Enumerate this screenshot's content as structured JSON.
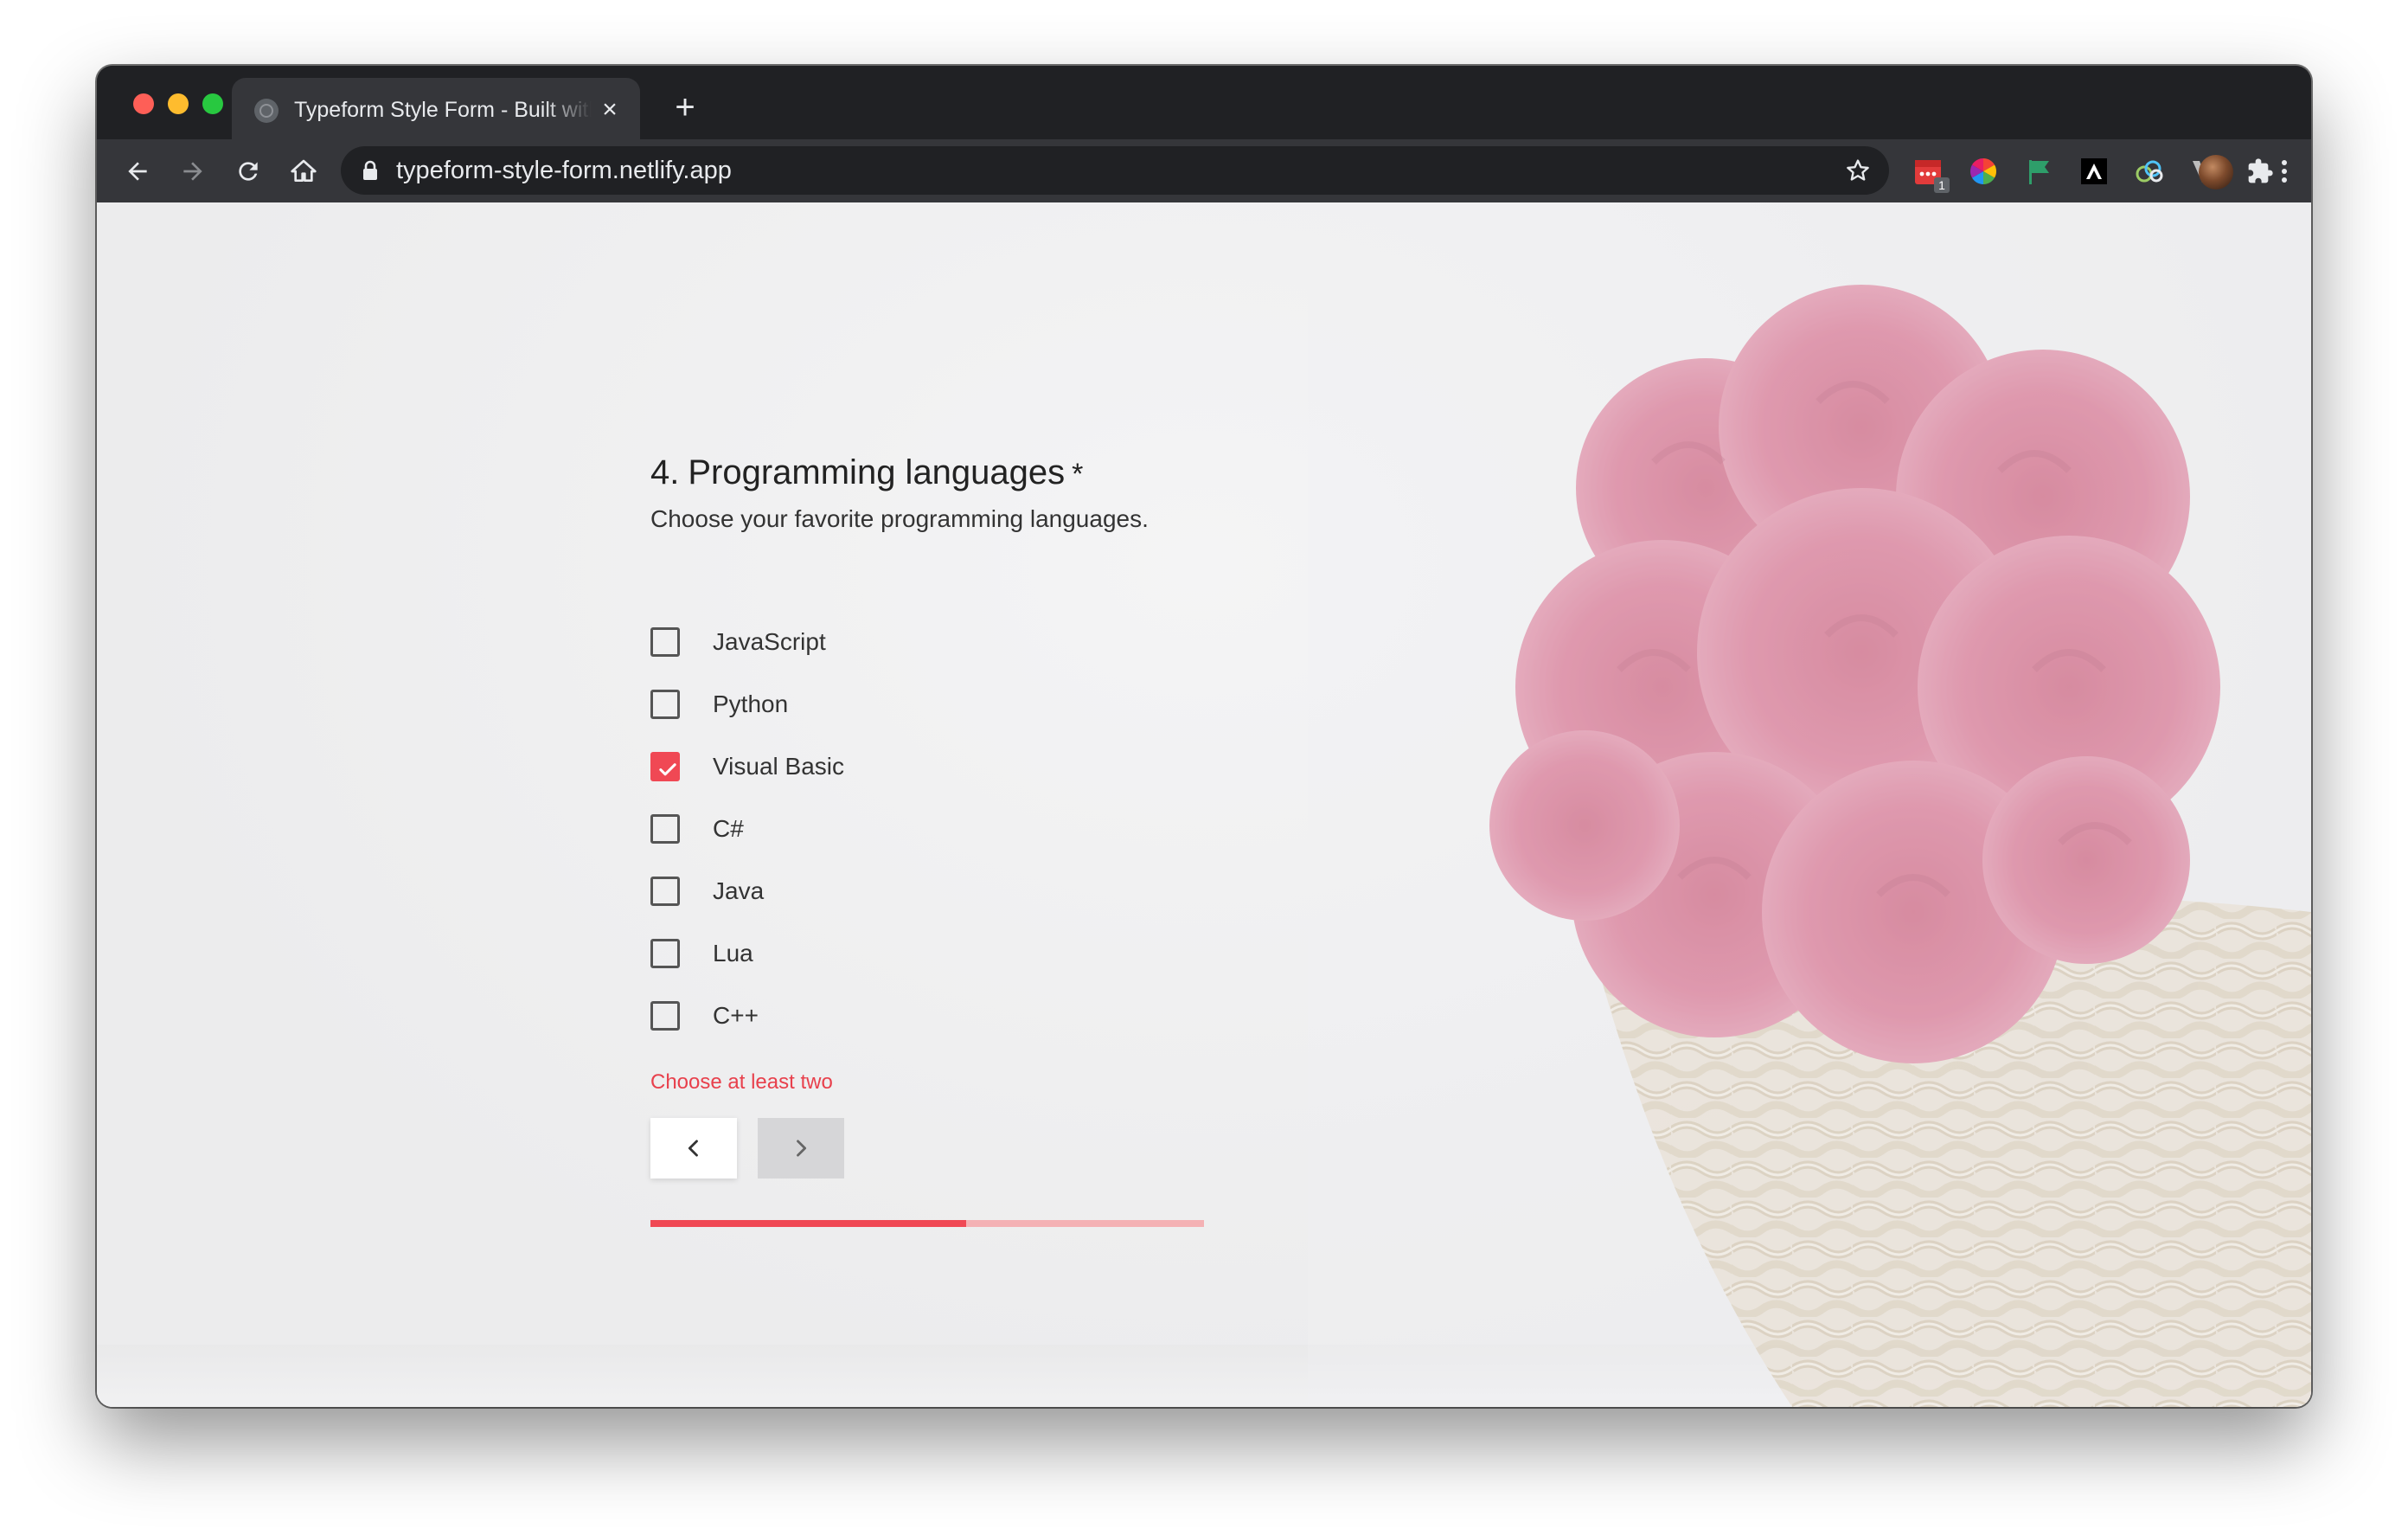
{
  "browser": {
    "tab_title": "Typeform Style Form - Built with React",
    "url": "typeform-style-form.netlify.app",
    "extension_badge": "1"
  },
  "form": {
    "question_number": "4.",
    "question_title": "Programming languages",
    "required_mark": "*",
    "description": "Choose your favorite programming languages.",
    "options": [
      {
        "label": "JavaScript",
        "checked": false
      },
      {
        "label": "Python",
        "checked": false
      },
      {
        "label": "Visual Basic",
        "checked": true
      },
      {
        "label": "C#",
        "checked": false
      },
      {
        "label": "Java",
        "checked": false
      },
      {
        "label": "Lua",
        "checked": false
      },
      {
        "label": "C++",
        "checked": false
      }
    ],
    "error": "Choose at least two",
    "prev_icon": "chevron-left-icon",
    "next_icon": "chevron-right-icon",
    "progress": 0.57
  },
  "colors": {
    "accent": "#f04854",
    "progress_track": "#f4b1b4",
    "error": "#e8404c"
  }
}
